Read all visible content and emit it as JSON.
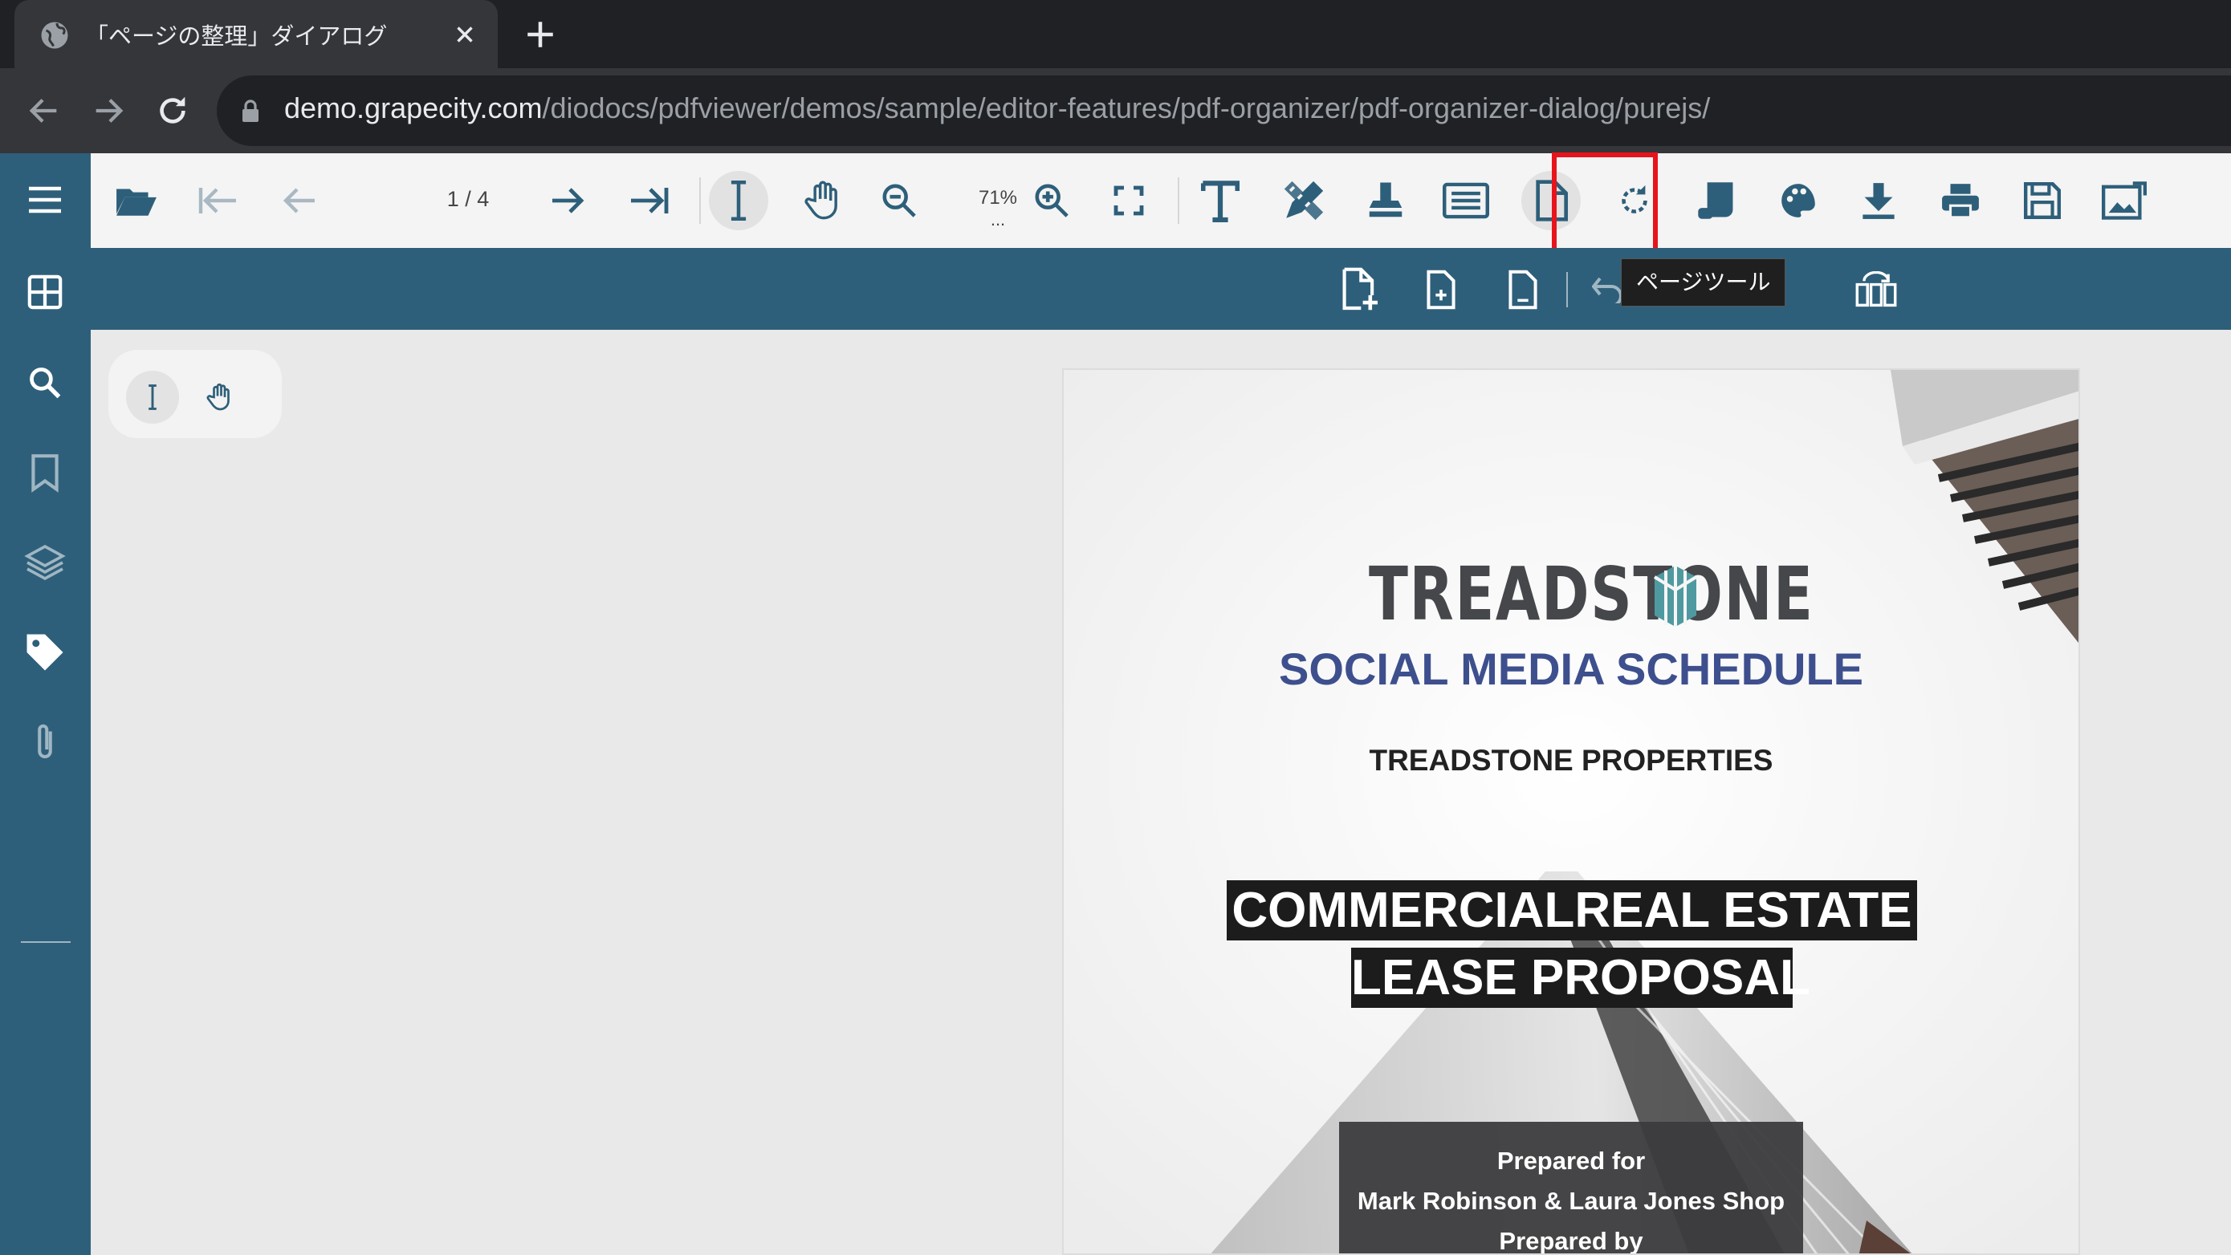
{
  "browser": {
    "tab_title": "「ページの整理」ダイアログ",
    "url_host": "demo.grapecity.com",
    "url_path": "/diodocs/pdfviewer/demos/sample/editor-features/pdf-organizer/pdf-organizer-dialog/purejs/"
  },
  "toolbar": {
    "page_indicator": "1 / 4",
    "zoom": "71%",
    "zoom_dots": "..."
  },
  "tooltip": "ページツール",
  "document": {
    "brand": "TREADSTONE",
    "subtitle": "SOCIAL MEDIA SCHEDULE",
    "company": "TREADSTONE PROPERTIES",
    "headline_line1": "COMMERCIALREAL ESTATE",
    "headline_line2": "LEASE PROPOSAL",
    "prepared_for_label": "Prepared for",
    "prepared_for": "Mark Robinson & Laura Jones Shop",
    "prepared_by_label": "Prepared by"
  },
  "colors": {
    "sidebar": "#2e5f7a",
    "toolbar": "#f4f4f4",
    "highlight": "#e8141c",
    "subtitle": "#3e4f8e"
  }
}
